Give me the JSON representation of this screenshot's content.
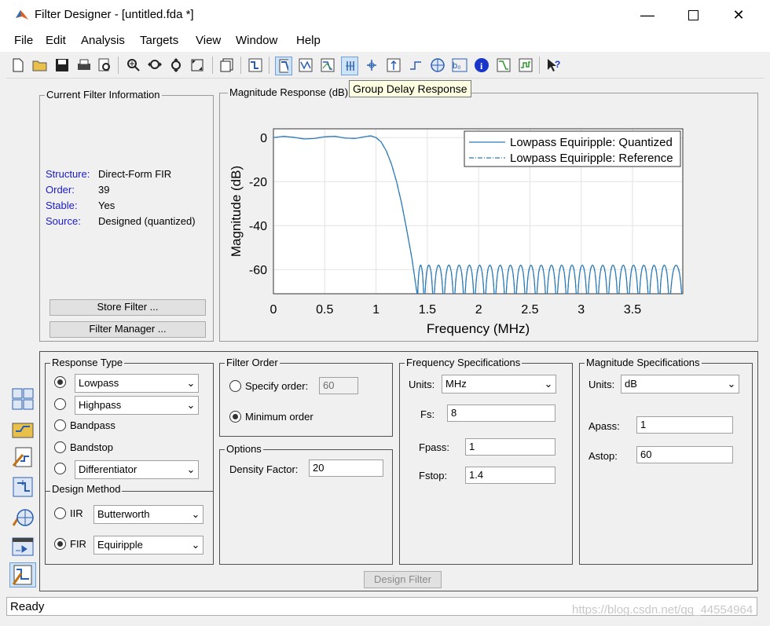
{
  "window": {
    "title": "Filter Designer  -  [untitled.fda *]"
  },
  "menu": [
    "File",
    "Edit",
    "Analysis",
    "Targets",
    "View",
    "Window",
    "Help"
  ],
  "tooltip": "Group Delay Response",
  "current_filter": {
    "title": "Current Filter Information",
    "structure_label": "Structure:",
    "structure_value": "Direct-Form FIR",
    "order_label": "Order:",
    "order_value": "39",
    "stable_label": "Stable:",
    "stable_value": "Yes",
    "source_label": "Source:",
    "source_value": "Designed (quantized)",
    "store_button": "Store Filter ...",
    "manager_button": "Filter Manager ..."
  },
  "plot_panel": {
    "title": "Magnitude Response (dB)"
  },
  "chart_data": {
    "type": "line",
    "xlabel": "Frequency (MHz)",
    "ylabel": "Magnitude (dB)",
    "xlim": [
      0,
      3.99
    ],
    "ylim": [
      -71,
      4
    ],
    "xticks": [
      "0",
      "0.5",
      "1",
      "1.5",
      "2",
      "2.5",
      "3",
      "3.5"
    ],
    "yticks": [
      "0",
      "-20",
      "-40",
      "-60"
    ],
    "grid": true,
    "legend_position": "top-right",
    "series": [
      {
        "name": "Lowpass Equiripple: Quantized",
        "style": "solid",
        "color": "#2a7ab8"
      },
      {
        "name": "Lowpass Equiripple: Reference",
        "style": "dash-dot",
        "color": "#2a7ab8"
      }
    ],
    "passband_x": [
      0,
      0.1,
      0.2,
      0.3,
      0.4,
      0.5,
      0.6,
      0.7,
      0.8,
      0.9,
      0.95,
      1.0,
      1.05,
      1.1,
      1.15,
      1.2,
      1.25,
      1.3,
      1.35,
      1.4
    ],
    "passband_y": [
      0,
      0.6,
      0.1,
      -0.6,
      -0.4,
      0.4,
      0.6,
      -0.2,
      -0.4,
      0.5,
      0.8,
      0,
      -2,
      -6,
      -12,
      -20,
      -30,
      -42,
      -55,
      -71
    ],
    "stopband_lobe_edges_mhz": [
      1.4,
      1.47,
      1.56,
      1.66,
      1.76,
      1.86,
      1.96,
      2.06,
      2.16,
      2.26,
      2.36,
      2.46,
      2.56,
      2.66,
      2.76,
      2.86,
      2.96,
      3.06,
      3.16,
      3.26,
      3.36,
      3.46,
      3.56,
      3.66,
      3.76,
      3.86,
      3.99
    ],
    "stopband_peak_db": -58
  },
  "response_type": {
    "title": "Response Type",
    "lowpass": "Lowpass",
    "highpass": "Highpass",
    "bandpass": "Bandpass",
    "bandstop": "Bandstop",
    "differentiator": "Differentiator"
  },
  "design_method": {
    "title": "Design Method",
    "iir": "IIR",
    "iir_value": "Butterworth",
    "fir": "FIR",
    "fir_value": "Equiripple"
  },
  "filter_order": {
    "title": "Filter Order",
    "specify_label": "Specify order:",
    "specify_value": "60",
    "minimum_label": "Minimum order"
  },
  "options": {
    "title": "Options",
    "density_label": "Density Factor:",
    "density_value": "20"
  },
  "freq_specs": {
    "title": "Frequency Specifications",
    "units_label": "Units:",
    "units_value": "MHz",
    "fs_label": "Fs:",
    "fs_value": "8",
    "fpass_label": "Fpass:",
    "fpass_value": "1",
    "fstop_label": "Fstop:",
    "fstop_value": "1.4"
  },
  "mag_specs": {
    "title": "Magnitude Specifications",
    "units_label": "Units:",
    "units_value": "dB",
    "apass_label": "Apass:",
    "apass_value": "1",
    "astop_label": "Astop:",
    "astop_value": "60"
  },
  "design_button": "Design Filter",
  "status": "Ready",
  "watermark": "https://blog.csdn.net/qq_44554964"
}
